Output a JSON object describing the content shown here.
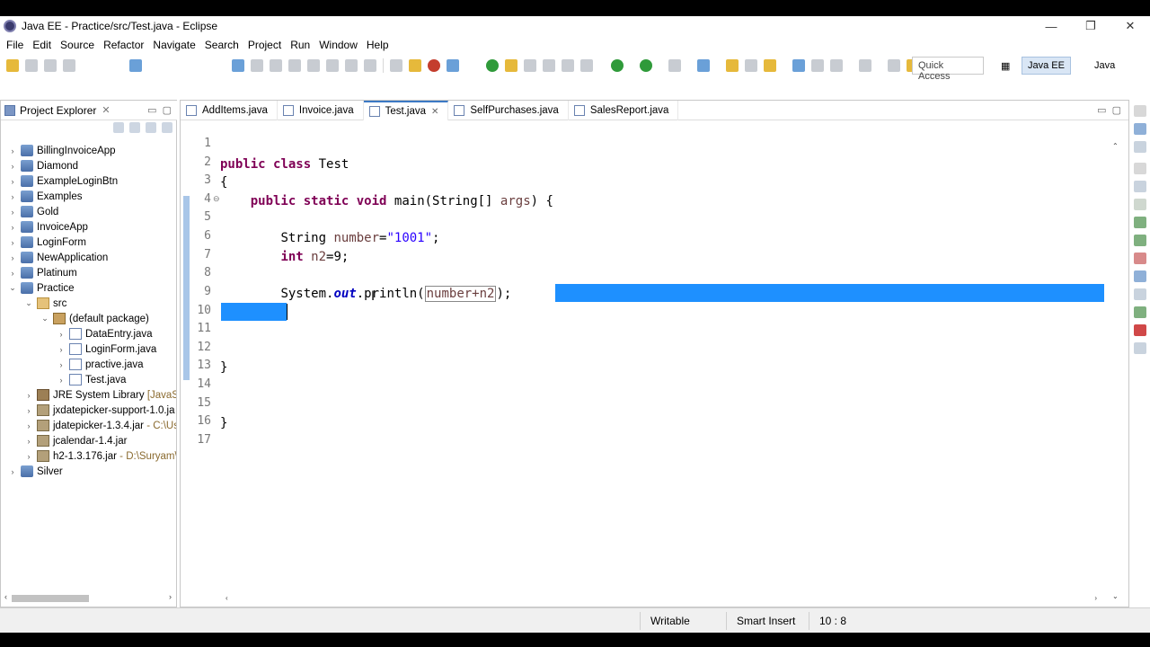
{
  "window": {
    "title": "Java EE - Practice/src/Test.java - Eclipse",
    "controls": [
      "—",
      "❐",
      "✕"
    ]
  },
  "menu": [
    "File",
    "Edit",
    "Source",
    "Refactor",
    "Navigate",
    "Search",
    "Project",
    "Run",
    "Window",
    "Help"
  ],
  "toolbar": {
    "quick_access_placeholder": "Quick Access",
    "perspectives": [
      "Java EE",
      "Java"
    ]
  },
  "project_explorer": {
    "title": "Project Explorer",
    "items": [
      {
        "label": "BillingInvoiceApp",
        "icon": "project-icon"
      },
      {
        "label": "Diamond",
        "icon": "project-icon"
      },
      {
        "label": "ExampleLoginBtn",
        "icon": "project-icon"
      },
      {
        "label": "Examples",
        "icon": "project-icon"
      },
      {
        "label": "Gold",
        "icon": "project-icon"
      },
      {
        "label": "InvoiceApp",
        "icon": "project-icon"
      },
      {
        "label": "LoginForm",
        "icon": "project-icon"
      },
      {
        "label": "NewApplication",
        "icon": "project-icon"
      },
      {
        "label": "Platinum",
        "icon": "project-icon"
      },
      {
        "label": "Practice",
        "icon": "project-icon"
      },
      {
        "label": "src",
        "icon": "source-folder-icon"
      },
      {
        "label": "(default package)",
        "icon": "package-icon"
      },
      {
        "label": "DataEntry.java",
        "icon": "java-file-icon"
      },
      {
        "label": "LoginForm.java",
        "icon": "java-file-icon"
      },
      {
        "label": "practive.java",
        "icon": "java-file-icon"
      },
      {
        "label": "Test.java",
        "icon": "java-file-icon"
      },
      {
        "label": "JRE System Library",
        "suffix": "[JavaSE-",
        "icon": "library-icon"
      },
      {
        "label": "jxdatepicker-support-1.0.ja",
        "icon": "jar-icon"
      },
      {
        "label": "jdatepicker-1.3.4.jar",
        "suffix": "- C:\\Us",
        "icon": "jar-icon"
      },
      {
        "label": "jcalendar-1.4.jar",
        "icon": "jar-icon"
      },
      {
        "label": "h2-1.3.176.jar",
        "suffix": "- D:\\Suryam\\",
        "icon": "jar-icon"
      },
      {
        "label": "Silver",
        "icon": "project-icon"
      }
    ]
  },
  "editor": {
    "tabs": [
      {
        "label": "AddItems.java",
        "active": false
      },
      {
        "label": "Invoice.java",
        "active": false
      },
      {
        "label": "Test.java",
        "active": true
      },
      {
        "label": "SelfPurchases.java",
        "active": false
      },
      {
        "label": "SalesReport.java",
        "active": false
      }
    ],
    "line_numbers": [
      "1",
      "2",
      "3",
      "4",
      "5",
      "6",
      "7",
      "8",
      "9",
      "10",
      "11",
      "12",
      "13",
      "14",
      "15",
      "16",
      "17"
    ],
    "code": {
      "l2_kw1": "public",
      "l2_kw2": "class",
      "l2_name": "Test",
      "l3": "{",
      "l4_kw1": "public",
      "l4_kw2": "static",
      "l4_kw3": "void",
      "l4_rest": "main(String[] ",
      "l4_param": "args",
      "l4_end": ") {",
      "l6_type": "String ",
      "l6_var": "number",
      "l6_eq": "=",
      "l6_str": "\"1001\"",
      "l6_end": ";",
      "l7_kw": "int",
      "l7_var": "n2",
      "l7_rest": "=9;",
      "l9_a": "System.",
      "l9_field": "out",
      "l9_b": ".println(",
      "l9_arg": "number+n2",
      "l9_c": ");",
      "l13": "}",
      "l16": "}"
    }
  },
  "status": {
    "writable": "Writable",
    "insert_mode": "Smart Insert",
    "position": "10 : 8"
  },
  "colors": {
    "keyword": "#7f0055",
    "string": "#2a00ff",
    "selection": "#1e90ff"
  }
}
